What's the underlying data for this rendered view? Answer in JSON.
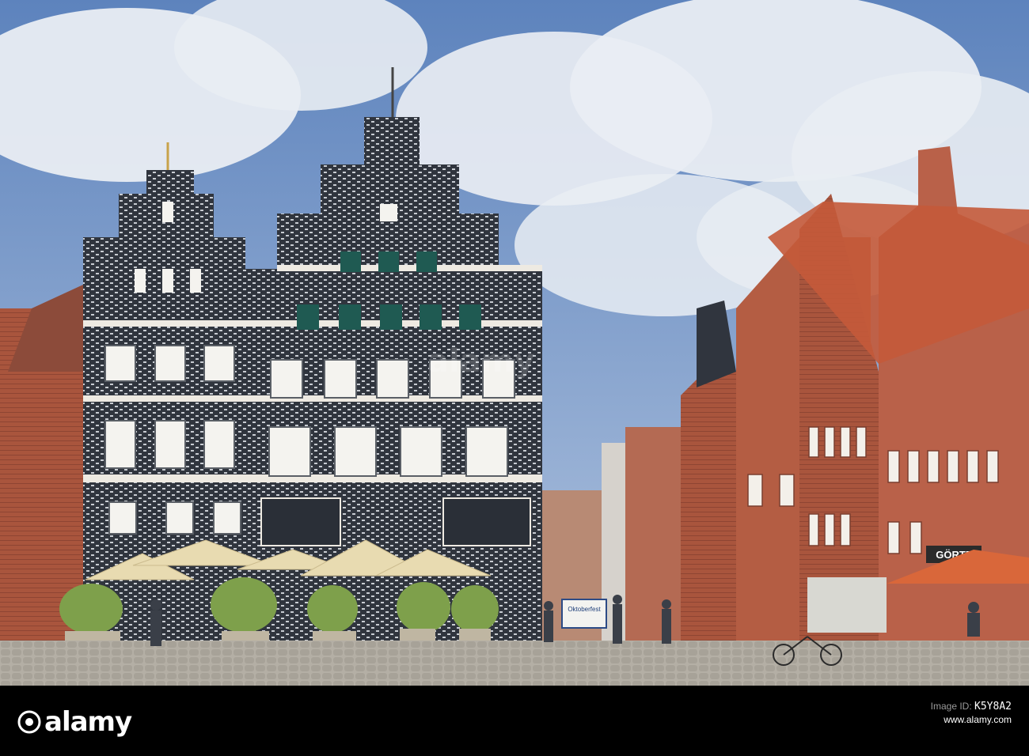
{
  "photo": {
    "subject": "Town square with historic gabled brick buildings",
    "sign_text": "Oktoberfest",
    "shop_text": "GÖRTZ",
    "watermark": "alamy"
  },
  "footer": {
    "logo": "alamy",
    "image_id_label": "Image ID:",
    "image_id": "K5Y8A2",
    "site": "www.alamy.com",
    "logo_icon": "alamy-logo-icon"
  },
  "colors": {
    "sky": "#6a8fc4",
    "dark_facade": "#2e333c",
    "brick": "#a8573f",
    "roof": "#c75b3c",
    "umbrella": "#e7d9ad",
    "orange_umbrella": "#d9673a",
    "cobble": "#b2ada3"
  }
}
